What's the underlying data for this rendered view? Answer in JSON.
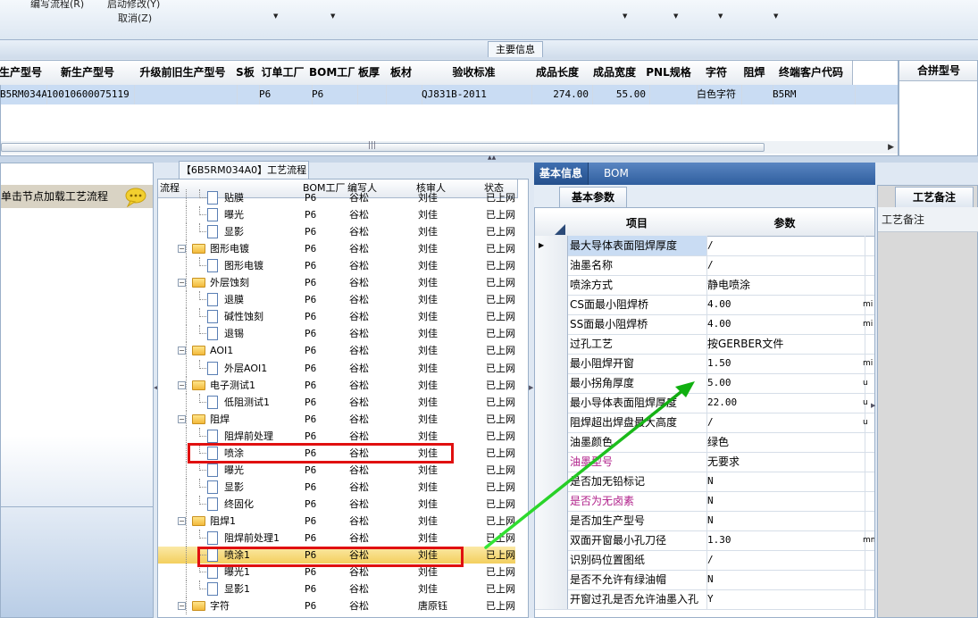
{
  "toolbar": {
    "edit_flow": "编写流程(R)",
    "start_edit": "启动修改(Y)",
    "cancel": "取消(Z)"
  },
  "main_info": {
    "title": "主要信息",
    "columns": [
      "生产型号",
      "新生产型号",
      "升级前旧生产型号",
      "S板",
      "订单工厂",
      "BOM工厂",
      "板厚",
      "板材",
      "验收标准",
      "成品长度",
      "成品宽度",
      "PNL规格",
      "字符",
      "阻焊",
      "终端客户代码"
    ],
    "row": [
      "B5RM034A0",
      "10010600075119",
      "",
      "",
      "P6",
      "P6",
      "",
      "",
      "QJ831B-2011",
      "274.00",
      "55.00",
      "",
      "白色字符",
      "",
      "B5RM"
    ],
    "merge_title": "合拼型号"
  },
  "left_panel": {
    "hint": "单击节点加载工艺流程",
    "chat_icon": "speech-bubble-icon"
  },
  "process": {
    "title": "【6B5RM034A0】工艺流程",
    "columns": [
      "流程",
      "BOM工厂",
      "编写人",
      "核审人",
      "状态"
    ],
    "rows": [
      {
        "name": "贴膜",
        "level": 1,
        "type": "doc",
        "bom": "P6",
        "writer": "谷松",
        "reviewer": "刘佳",
        "status": "已上网"
      },
      {
        "name": "曝光",
        "level": 1,
        "type": "doc",
        "bom": "P6",
        "writer": "谷松",
        "reviewer": "刘佳",
        "status": "已上网"
      },
      {
        "name": "显影",
        "level": 1,
        "type": "doc",
        "bom": "P6",
        "writer": "谷松",
        "reviewer": "刘佳",
        "status": "已上网"
      },
      {
        "name": "图形电镀",
        "level": 0,
        "type": "folder",
        "bom": "P6",
        "writer": "谷松",
        "reviewer": "刘佳",
        "status": "已上网"
      },
      {
        "name": "图形电镀",
        "level": 1,
        "type": "doc",
        "bom": "P6",
        "writer": "谷松",
        "reviewer": "刘佳",
        "status": "已上网"
      },
      {
        "name": "外层蚀刻",
        "level": 0,
        "type": "folder",
        "bom": "P6",
        "writer": "谷松",
        "reviewer": "刘佳",
        "status": "已上网"
      },
      {
        "name": "退膜",
        "level": 1,
        "type": "doc",
        "bom": "P6",
        "writer": "谷松",
        "reviewer": "刘佳",
        "status": "已上网"
      },
      {
        "name": "碱性蚀刻",
        "level": 1,
        "type": "doc",
        "bom": "P6",
        "writer": "谷松",
        "reviewer": "刘佳",
        "status": "已上网"
      },
      {
        "name": "退锡",
        "level": 1,
        "type": "doc",
        "bom": "P6",
        "writer": "谷松",
        "reviewer": "刘佳",
        "status": "已上网"
      },
      {
        "name": "AOI1",
        "level": 0,
        "type": "folder",
        "bom": "P6",
        "writer": "谷松",
        "reviewer": "刘佳",
        "status": "已上网"
      },
      {
        "name": "外层AOI1",
        "level": 1,
        "type": "doc",
        "bom": "P6",
        "writer": "谷松",
        "reviewer": "刘佳",
        "status": "已上网"
      },
      {
        "name": "电子测试1",
        "level": 0,
        "type": "folder",
        "bom": "P6",
        "writer": "谷松",
        "reviewer": "刘佳",
        "status": "已上网"
      },
      {
        "name": "低阻测试1",
        "level": 1,
        "type": "doc",
        "bom": "P6",
        "writer": "谷松",
        "reviewer": "刘佳",
        "status": "已上网"
      },
      {
        "name": "阻焊",
        "level": 0,
        "type": "folder",
        "bom": "P6",
        "writer": "谷松",
        "reviewer": "刘佳",
        "status": "已上网"
      },
      {
        "name": "阻焊前处理",
        "level": 1,
        "type": "doc",
        "bom": "P6",
        "writer": "谷松",
        "reviewer": "刘佳",
        "status": "已上网"
      },
      {
        "name": "喷涂",
        "level": 1,
        "type": "doc",
        "bom": "P6",
        "writer": "谷松",
        "reviewer": "刘佳",
        "status": "已上网"
      },
      {
        "name": "曝光",
        "level": 1,
        "type": "doc",
        "bom": "P6",
        "writer": "谷松",
        "reviewer": "刘佳",
        "status": "已上网"
      },
      {
        "name": "显影",
        "level": 1,
        "type": "doc",
        "bom": "P6",
        "writer": "谷松",
        "reviewer": "刘佳",
        "status": "已上网"
      },
      {
        "name": "终固化",
        "level": 1,
        "type": "doc",
        "bom": "P6",
        "writer": "谷松",
        "reviewer": "刘佳",
        "status": "已上网"
      },
      {
        "name": "阻焊1",
        "level": 0,
        "type": "folder",
        "bom": "P6",
        "writer": "谷松",
        "reviewer": "刘佳",
        "status": "已上网"
      },
      {
        "name": "阻焊前处理1",
        "level": 1,
        "type": "doc",
        "bom": "P6",
        "writer": "谷松",
        "reviewer": "刘佳",
        "status": "已上网"
      },
      {
        "name": "喷涂1",
        "level": 1,
        "type": "doc",
        "bom": "P6",
        "writer": "谷松",
        "reviewer": "刘佳",
        "status": "已上网",
        "selected": true
      },
      {
        "name": "曝光1",
        "level": 1,
        "type": "doc",
        "bom": "P6",
        "writer": "谷松",
        "reviewer": "刘佳",
        "status": "已上网"
      },
      {
        "name": "显影1",
        "level": 1,
        "type": "doc",
        "bom": "P6",
        "writer": "谷松",
        "reviewer": "刘佳",
        "status": "已上网"
      },
      {
        "name": "字符",
        "level": 0,
        "type": "folder",
        "bom": "P6",
        "writer": "谷松",
        "reviewer": "唐原钰",
        "status": "已上网"
      }
    ]
  },
  "params": {
    "tabs": [
      "基本信息",
      "BOM"
    ],
    "subtab": "基本参数",
    "columns": [
      "项目",
      "参数"
    ],
    "rows": [
      {
        "item": "最大导体表面阻焊厚度",
        "value": "/",
        "unit": ""
      },
      {
        "item": "油墨名称",
        "value": "/",
        "unit": ""
      },
      {
        "item": "喷涂方式",
        "value": "静电喷涂",
        "unit": ""
      },
      {
        "item": "CS面最小阻焊桥",
        "value": "4.00",
        "unit": "mi"
      },
      {
        "item": "SS面最小阻焊桥",
        "value": "4.00",
        "unit": "mi"
      },
      {
        "item": "过孔工艺",
        "value": "按GERBER文件",
        "unit": ""
      },
      {
        "item": "最小阻焊开窗",
        "value": "1.50",
        "unit": "mi"
      },
      {
        "item": "最小拐角厚度",
        "value": "5.00",
        "unit": "u"
      },
      {
        "item": "最小导体表面阻焊厚度",
        "value": "22.00",
        "unit": "u"
      },
      {
        "item": "阻焊超出焊盘最大高度",
        "value": "/",
        "unit": "u"
      },
      {
        "item": "油墨颜色",
        "value": "绿色",
        "unit": ""
      },
      {
        "item": "油墨型号",
        "value": "无要求",
        "unit": "",
        "color": "#b0208a"
      },
      {
        "item": "是否加无铅标记",
        "value": "N",
        "unit": ""
      },
      {
        "item": "是否为无卤素",
        "value": "N",
        "unit": "",
        "color": "#b0208a"
      },
      {
        "item": "是否加生产型号",
        "value": "N",
        "unit": ""
      },
      {
        "item": "双面开窗最小孔刀径",
        "value": "1.30",
        "unit": "mm"
      },
      {
        "item": "识别码位置图纸",
        "value": "/",
        "unit": ""
      },
      {
        "item": "是否不允许有绿油帽",
        "value": "N",
        "unit": ""
      },
      {
        "item": "开窗过孔是否允许油墨入孔",
        "value": "Y",
        "unit": ""
      }
    ]
  },
  "notes": {
    "tab": "工艺备注",
    "header": "工艺备注"
  },
  "colors": {
    "accent": "#2f5e9e",
    "selection": "#c9dcf3",
    "highlight_box": "#e01010",
    "arrow": "#22cc22"
  }
}
